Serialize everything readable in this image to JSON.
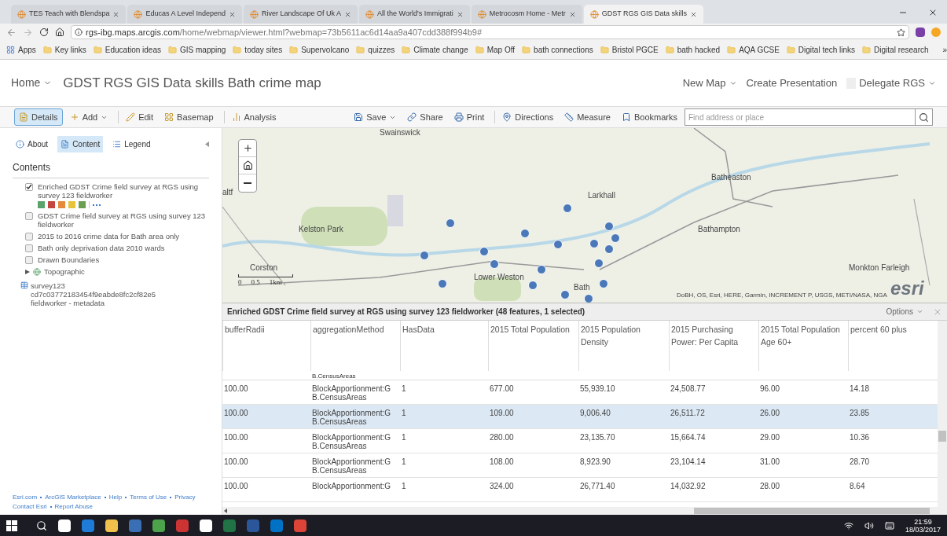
{
  "browser": {
    "tabs": [
      {
        "label": "TES Teach with Blendspa",
        "selected": false
      },
      {
        "label": "Educas A Level Independ",
        "selected": false
      },
      {
        "label": "River Landscape Of Uk A",
        "selected": false
      },
      {
        "label": "All the World's Immigrati",
        "selected": false
      },
      {
        "label": "Metrocosm Home - Metr",
        "selected": false
      },
      {
        "label": "GDST RGS GIS Data skills",
        "selected": true
      }
    ],
    "url_host": "rgs-ibg.maps.arcgis.com",
    "url_path": "/home/webmap/viewer.html?webmap=73b5611ac6d14aa9a407cdd388f994b9#",
    "bookmarks": [
      "Apps",
      "Key links",
      "Education ideas",
      "GIS mapping",
      "today sites",
      "Supervolcano",
      "quizzes",
      "Climate change",
      "Map Off",
      "bath connections",
      "Bristol PGCE",
      "bath hacked",
      "AQA GCSE",
      "Digital tech links",
      "Digital research"
    ],
    "more": "»"
  },
  "header": {
    "home": "Home",
    "title": "GDST RGS GIS Data skills Bath crime map",
    "links": [
      "New Map",
      "Create Presentation"
    ],
    "user": "Delegate RGS"
  },
  "toolbar": {
    "left": [
      {
        "label": "Details",
        "selected": true,
        "dropdown": false
      },
      {
        "label": "Add",
        "selected": false,
        "dropdown": true
      },
      {
        "label": "Edit",
        "selected": false,
        "dropdown": false
      },
      {
        "label": "Basemap",
        "selected": false,
        "dropdown": false
      },
      {
        "label": "Analysis",
        "selected": false,
        "dropdown": false
      }
    ],
    "right": [
      {
        "label": "Save",
        "dropdown": true
      },
      {
        "label": "Share",
        "dropdown": false
      },
      {
        "label": "Print",
        "dropdown": false
      },
      {
        "label": "Directions",
        "dropdown": false
      },
      {
        "label": "Measure",
        "dropdown": false
      },
      {
        "label": "Bookmarks",
        "dropdown": false
      }
    ],
    "search": {
      "placeholder": "Find address or place"
    }
  },
  "sidebar": {
    "tabs": [
      {
        "label": "About",
        "selected": false
      },
      {
        "label": "Content",
        "selected": true
      },
      {
        "label": "Legend",
        "selected": false
      }
    ],
    "heading": "Contents",
    "layers": [
      {
        "kind": "layer",
        "label": "Enriched GDST Crime field survey at RGS using survey 123 fieldworker",
        "checked": true,
        "tools": true
      },
      {
        "kind": "layer",
        "label": "GDST Crime field survey at RGS using survey 123 fieldworker",
        "checked": false,
        "tools": false
      },
      {
        "kind": "layer",
        "label": "2015 to 2016 crime data for Bath area only",
        "checked": false,
        "tools": false
      },
      {
        "kind": "layer",
        "label": "Bath only deprivation data 2010 wards",
        "checked": false,
        "tools": false
      },
      {
        "kind": "layer",
        "label": "Drawn Boundaries",
        "checked": false,
        "tools": false
      },
      {
        "kind": "basemap",
        "label": "Topographic",
        "expanded": false
      },
      {
        "kind": "table",
        "label": "survey123 cd7c03772183454f9eabde8fc2cf82e5 fieldworker - metadata"
      }
    ],
    "footer": [
      "Esri.com",
      "ArcGIS Marketplace",
      "Help",
      "Terms of Use",
      "Privacy",
      "Contact Esri",
      "Report Abuse"
    ]
  },
  "map": {
    "places": [
      "Swainswick",
      "Batheaston",
      "altf",
      "Larkhall",
      "Kelston Park",
      "Bathampton",
      "Corston",
      "Monkton Farleigh",
      "Lower Weston",
      "Bath"
    ],
    "scale": [
      "0",
      "0.5",
      "1km"
    ],
    "attribution": "DoBH, OS, Esri, HERE, Garmin, INCREMENT P, USGS, METI/NASA, NGA",
    "logo": "esri"
  },
  "table": {
    "title": "Enriched GDST Crime field survey at RGS using survey 123 fieldworker (48 features, 1 selected)",
    "options": "Options",
    "columns": [
      "bufferRadii",
      "aggregationMethod",
      "HasData",
      "2015 Total Population",
      "2015 Population Density",
      "2015 Purchasing Power: Per Capita",
      "2015 Total Population Age 60+",
      "percent 60 plus"
    ],
    "partial_row": "B.CensusAreas",
    "rows": [
      {
        "selected": false,
        "cells": [
          "100.00",
          "BlockApportionment:G B.CensusAreas",
          "1",
          "677.00",
          "55,939.10",
          "24,508.77",
          "96.00",
          "14.18"
        ]
      },
      {
        "selected": true,
        "cells": [
          "100.00",
          "BlockApportionment:G B.CensusAreas",
          "1",
          "109.00",
          "9,006.40",
          "26,511.72",
          "26.00",
          "23.85"
        ]
      },
      {
        "selected": false,
        "cells": [
          "100.00",
          "BlockApportionment:G B.CensusAreas",
          "1",
          "280.00",
          "23,135.70",
          "15,664.74",
          "29.00",
          "10.36"
        ]
      },
      {
        "selected": false,
        "cells": [
          "100.00",
          "BlockApportionment:G B.CensusAreas",
          "1",
          "108.00",
          "8,923.90",
          "23,104.14",
          "31.00",
          "28.70"
        ]
      },
      {
        "selected": false,
        "cells": [
          "100.00",
          "BlockApportionment:G",
          "1",
          "324.00",
          "26,771.40",
          "14,032.92",
          "28.00",
          "8.64"
        ]
      }
    ]
  },
  "taskbar": {
    "time": "21:59",
    "date": "18/03/2017"
  }
}
